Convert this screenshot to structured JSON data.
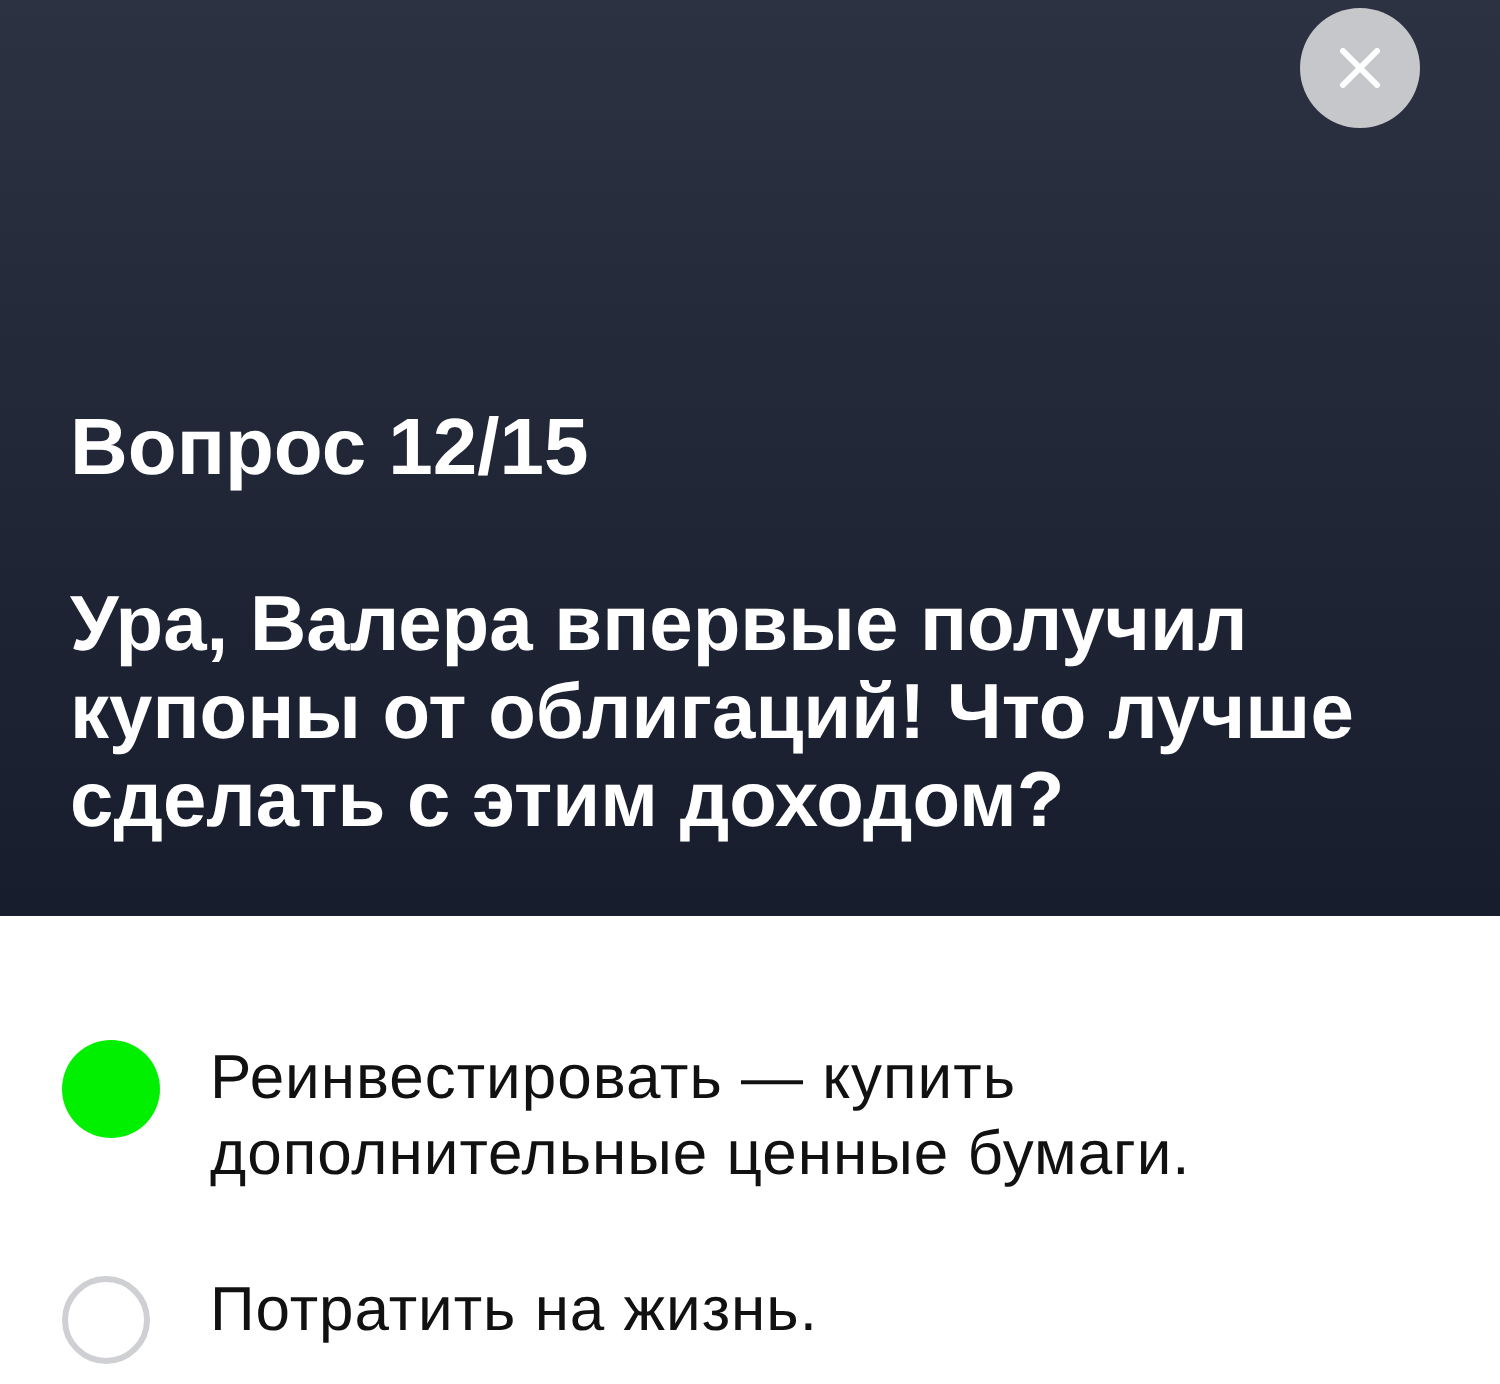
{
  "close_button": {
    "kind": "close"
  },
  "question": {
    "counter": "Вопрос 12/15",
    "text": "Ура, Валера впервые получил купоны от облигаций! Что лучше сделать с этим доходом?"
  },
  "options": [
    {
      "label": "Реинвестировать — купить дополнительные ценные бумаги.",
      "selected": true
    },
    {
      "label": "Потратить на жизнь.",
      "selected": false
    }
  ]
}
